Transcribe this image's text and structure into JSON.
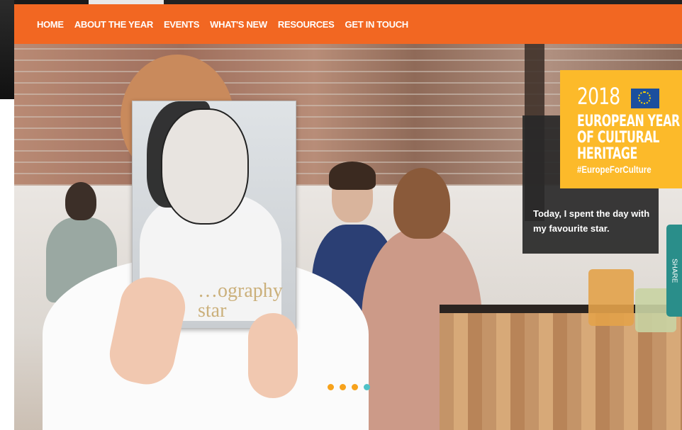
{
  "nav": {
    "items": [
      "HOME",
      "ABOUT THE YEAR",
      "EVENTS",
      "WHAT'S NEW",
      "RESOURCES",
      "GET IN TOUCH"
    ]
  },
  "hero": {
    "caption": "Today, I spent the day with my favourite star.",
    "magazine_text": "…ography\nstar",
    "side_tab": "SHARE",
    "slides": {
      "total": 4,
      "active": 4
    }
  },
  "badge": {
    "year": "2018",
    "line1": "EUROPEAN YEAR",
    "line2": "OF CULTURAL",
    "line3": "HERITAGE",
    "hashtag": "#EuropeForCulture"
  },
  "colors": {
    "nav_bg": "#f26722",
    "badge_bg": "#fcba2a",
    "dot": "#f7a21b",
    "dot_active": "#4fc2c7",
    "side_tab": "#2a8e8a"
  }
}
